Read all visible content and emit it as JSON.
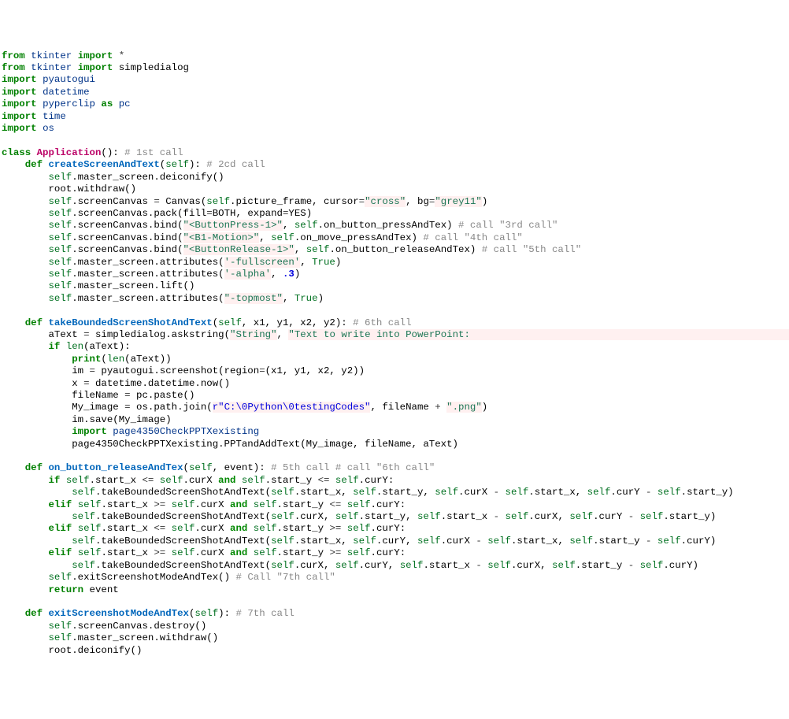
{
  "line01_from": "from",
  "line01_mod": "tkinter",
  "line01_imp": "import",
  "line01_star": "*",
  "line02_from": "from",
  "line02_mod": "tkinter",
  "line02_imp": "import",
  "line02_name": "simpledialog",
  "line03_imp": "import",
  "line03_mod": "pyautogui",
  "line04_imp": "import",
  "line04_mod": "datetime",
  "line05_imp": "import",
  "line05_mod": "pyperclip",
  "line05_as": "as",
  "line05_alias": "pc",
  "line06_imp": "import",
  "line06_mod": "time",
  "line07_imp": "import",
  "line07_mod": "os",
  "line09_class": "class",
  "line09_name": "Application",
  "line09_paren": "():",
  "line09_cmt": "# 1st call",
  "line10_def": "def",
  "line10_name": "createScreenAndText",
  "line10_args": "(",
  "line10_self": "self",
  "line10_pe": "):",
  "line10_cmt": "# 2cd call",
  "line11_a": "self",
  "line11_b": ".master_screen.deiconify()",
  "line12": "root.withdraw()",
  "line13_a": "self",
  "line13_b": ".screenCanvas ",
  "line13_eq": "=",
  "line13_c": " Canvas(",
  "line13_d": "self",
  "line13_e": ".picture_frame, cursor",
  "line13_eq2": "=",
  "line13_s1": "\"cross\"",
  "line13_c2": ", bg",
  "line13_eq3": "=",
  "line13_s2": "\"grey11\"",
  "line13_end": ")",
  "line14_a": "self",
  "line14_b": ".screenCanvas.pack(fill",
  "line14_eq": "=",
  "line14_c": "BOTH, expand",
  "line14_eq2": "=",
  "line14_d": "YES)",
  "line15_a": "self",
  "line15_b": ".screenCanvas.bind(",
  "line15_s": "\"<ButtonPress-1>\"",
  "line15_c": ", ",
  "line15_d": "self",
  "line15_e": ".on_button_pressAndTex) ",
  "line15_cmt": "# call \"3rd call\"",
  "line16_a": "self",
  "line16_b": ".screenCanvas.bind(",
  "line16_s": "\"<B1-Motion>\"",
  "line16_c": ", ",
  "line16_d": "self",
  "line16_e": ".on_move_pressAndTex) ",
  "line16_cmt": "# call \"4th call\"",
  "line17_a": "self",
  "line17_b": ".screenCanvas.bind(",
  "line17_s": "\"<ButtonRelease-1>\"",
  "line17_c": ", ",
  "line17_d": "self",
  "line17_e": ".on_button_releaseAndTex) ",
  "line17_cmt": "# call \"5th call\"",
  "line18_a": "self",
  "line18_b": ".master_screen.attributes(",
  "line18_s": "'-fullscreen'",
  "line18_c": ", ",
  "line18_t": "True",
  "line18_end": ")",
  "line19_a": "self",
  "line19_b": ".master_screen.attributes(",
  "line19_s": "'-alpha'",
  "line19_c": ", ",
  "line19_n": ".3",
  "line19_end": ")",
  "line20_a": "self",
  "line20_b": ".master_screen.lift()",
  "line21_a": "self",
  "line21_b": ".master_screen.attributes(",
  "line21_s": "\"-topmost\"",
  "line21_c": ", ",
  "line21_t": "True",
  "line21_end": ")",
  "line23_def": "def",
  "line23_name": "takeBoundedScreenShotAndText",
  "line23_args": "(",
  "line23_self": "self",
  "line23_rest": ", x1, y1, x2, y2):",
  "line23_cmt": "# 6th call",
  "line24_a": "aText ",
  "line24_eq": "=",
  "line24_b": " simpledialog.askstring(",
  "line24_s1": "\"String\"",
  "line24_c": ", ",
  "line24_s2": "\"Text to write into PowerPoint:                                                             \"",
  "line24_end": ")",
  "line25_if": "if",
  "line25_rest": " ",
  "line25_len": "len",
  "line25_p": "(aText):",
  "line26_print": "print",
  "line26_p": "(",
  "line26_len": "len",
  "line26_rest": "(aText))",
  "line27_a": "im ",
  "line27_eq": "=",
  "line27_b": " pyautogui.screenshot(region",
  "line27_eq2": "=",
  "line27_c": "(x1, y1, x2, y2))",
  "line28_a": "x ",
  "line28_eq": "=",
  "line28_b": " datetime.datetime.now()",
  "line29_a": "fileName ",
  "line29_eq": "=",
  "line29_b": " pc.paste()",
  "line30_a": "My_image ",
  "line30_eq": "=",
  "line30_b": " os.path.join(",
  "line30_r": "r\"C:\\0Python\\0testingCodes\"",
  "line30_c": ", fileName ",
  "line30_plus": "+",
  "line30_d": " ",
  "line30_s": "\".png\"",
  "line30_end": ")",
  "line31": "im.save(My_image)",
  "line32_imp": "import",
  "line32_mod": "page4350CheckPPTXexisting",
  "line33": "page4350CheckPPTXexisting.PPTandAddText(My_image, fileName, aText)",
  "line35_def": "def",
  "line35_name": "on_button_releaseAndTex",
  "line35_o": "(",
  "line35_self": "self",
  "line35_rest": ", event):",
  "line35_cmt": "# 5th call # call \"6th call\"",
  "line36_if": "if",
  "line36_a": " ",
  "line36_s1": "self",
  "line36_b": ".start_x ",
  "line36_op1": "<=",
  "line36_c": " ",
  "line36_s2": "self",
  "line36_d": ".curX ",
  "line36_and": "and",
  "line36_e": " ",
  "line36_s3": "self",
  "line36_f": ".start_y ",
  "line36_op2": "<=",
  "line36_g": " ",
  "line36_s4": "self",
  "line36_h": ".curY:",
  "line37_s": "self",
  "line37_a": ".takeBoundedScreenShotAndText(",
  "line37_s2": "self",
  "line37_b": ".start_x, ",
  "line37_s3": "self",
  "line37_c": ".start_y, ",
  "line37_s4": "self",
  "line37_d": ".curX ",
  "line37_m1": "-",
  "line37_e": " ",
  "line37_s5": "self",
  "line37_f": ".start_x, ",
  "line37_s6": "self",
  "line37_g": ".curY ",
  "line37_m2": "-",
  "line37_h": " ",
  "line37_s7": "self",
  "line37_i": ".start_y)",
  "line38_elif": "elif",
  "line38_a": " ",
  "line38_s1": "self",
  "line38_b": ".start_x ",
  "line38_op1": ">=",
  "line38_c": " ",
  "line38_s2": "self",
  "line38_d": ".curX ",
  "line38_and": "and",
  "line38_e": " ",
  "line38_s3": "self",
  "line38_f": ".start_y ",
  "line38_op2": "<=",
  "line38_g": " ",
  "line38_s4": "self",
  "line38_h": ".curY:",
  "line39_s": "self",
  "line39_a": ".takeBoundedScreenShotAndText(",
  "line39_s2": "self",
  "line39_b": ".curX, ",
  "line39_s3": "self",
  "line39_c": ".start_y, ",
  "line39_s4": "self",
  "line39_d": ".start_x ",
  "line39_m1": "-",
  "line39_e": " ",
  "line39_s5": "self",
  "line39_f": ".curX, ",
  "line39_s6": "self",
  "line39_g": ".curY ",
  "line39_m2": "-",
  "line39_h": " ",
  "line39_s7": "self",
  "line39_i": ".start_y)",
  "line40_elif": "elif",
  "line40_a": " ",
  "line40_s1": "self",
  "line40_b": ".start_x ",
  "line40_op1": "<=",
  "line40_c": " ",
  "line40_s2": "self",
  "line40_d": ".curX ",
  "line40_and": "and",
  "line40_e": " ",
  "line40_s3": "self",
  "line40_f": ".start_y ",
  "line40_op2": ">=",
  "line40_g": " ",
  "line40_s4": "self",
  "line40_h": ".curY:",
  "line41_s": "self",
  "line41_a": ".takeBoundedScreenShotAndText(",
  "line41_s2": "self",
  "line41_b": ".start_x, ",
  "line41_s3": "self",
  "line41_c": ".curY, ",
  "line41_s4": "self",
  "line41_d": ".curX ",
  "line41_m1": "-",
  "line41_e": " ",
  "line41_s5": "self",
  "line41_f": ".start_x, ",
  "line41_s6": "self",
  "line41_g": ".start_y ",
  "line41_m2": "-",
  "line41_h": " ",
  "line41_s7": "self",
  "line41_i": ".curY)",
  "line42_elif": "elif",
  "line42_a": " ",
  "line42_s1": "self",
  "line42_b": ".start_x ",
  "line42_op1": ">=",
  "line42_c": " ",
  "line42_s2": "self",
  "line42_d": ".curX ",
  "line42_and": "and",
  "line42_e": " ",
  "line42_s3": "self",
  "line42_f": ".start_y ",
  "line42_op2": ">=",
  "line42_g": " ",
  "line42_s4": "self",
  "line42_h": ".curY:",
  "line43_s": "self",
  "line43_a": ".takeBoundedScreenShotAndText(",
  "line43_s2": "self",
  "line43_b": ".curX, ",
  "line43_s3": "self",
  "line43_c": ".curY, ",
  "line43_s4": "self",
  "line43_d": ".start_x ",
  "line43_m1": "-",
  "line43_e": " ",
  "line43_s5": "self",
  "line43_f": ".curX, ",
  "line43_s6": "self",
  "line43_g": ".start_y ",
  "line43_m2": "-",
  "line43_h": " ",
  "line43_s7": "self",
  "line43_i": ".curY)",
  "line44_s": "self",
  "line44_a": ".exitScreenshotModeAndTex() ",
  "line44_cmt": "# Call \"7th call\"",
  "line45_ret": "return",
  "line45_rest": " event",
  "line47_def": "def",
  "line47_name": "exitScreenshotModeAndTex",
  "line47_o": "(",
  "line47_self": "self",
  "line47_rest": "):",
  "line47_cmt": "# 7th call",
  "line48_s": "self",
  "line48_a": ".screenCanvas.destroy()",
  "line49_s": "self",
  "line49_a": ".master_screen.withdraw()",
  "line50": "root.deiconify()"
}
